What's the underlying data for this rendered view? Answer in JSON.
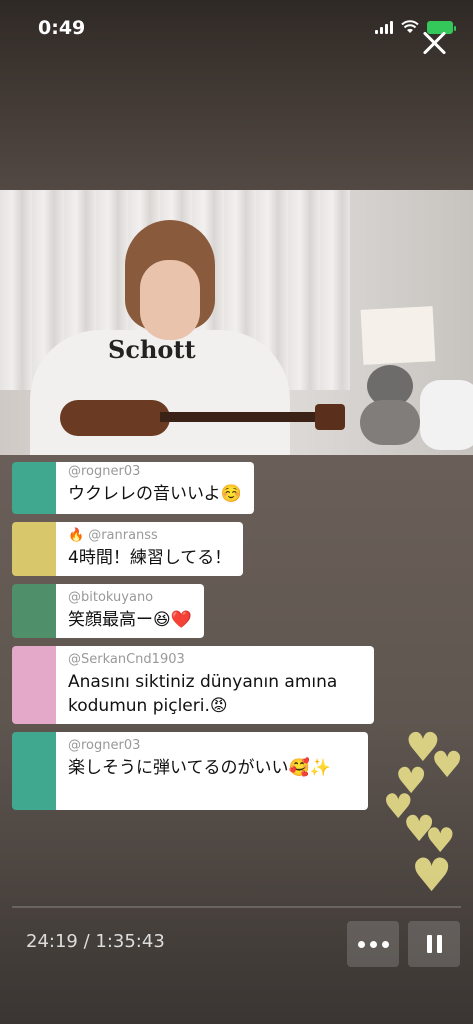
{
  "status": {
    "time": "0:49"
  },
  "playback": {
    "current": "24:19",
    "separator": " / ",
    "total": "1:35:43"
  },
  "video": {
    "shirt_logo": "Schott"
  },
  "comments": [
    {
      "user": "@rogner03",
      "text": "ウクレレの音いいよ☺️",
      "avatar_color": "#3fa88e",
      "has_flame": false
    },
    {
      "user": "@ranranss",
      "text": "4時間！練習してる！",
      "avatar_color": "#d8c86b",
      "has_flame": true
    },
    {
      "user": "@bitokuyano",
      "text": "笑顔最高ー😆❤️",
      "avatar_color": "#4f8f6a",
      "has_flame": false
    },
    {
      "user": "@SerkanCnd1903",
      "text": "Anasını siktiniz  dünyanın amına kodumun piçleri.😡",
      "avatar_color": "#e4a9c9",
      "has_flame": false
    },
    {
      "user": "@rogner03",
      "text": "楽しそうに弾いてるのがいい🥰✨",
      "avatar_color": "#3fa88e",
      "has_flame": false
    }
  ],
  "colors": {
    "heart": "#e8de8a",
    "battery": "#34c759"
  },
  "icons": [
    "signal-icon",
    "wifi-icon",
    "battery-icon",
    "close-icon",
    "more-icon",
    "pause-icon",
    "heart-icon",
    "flame-icon"
  ]
}
